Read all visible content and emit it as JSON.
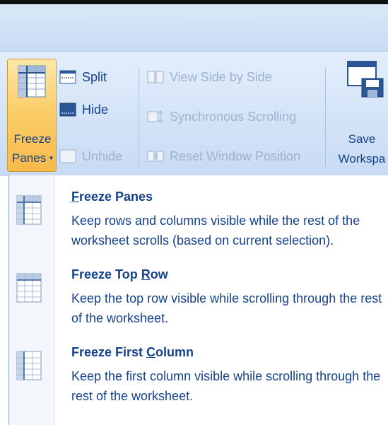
{
  "ribbon": {
    "freeze_panes": {
      "line1": "Freeze",
      "line2": "Panes",
      "caret": "▾"
    },
    "split": "Split",
    "hide": "Hide",
    "unhide": "Unhide",
    "view_side_by_side": "View Side by Side",
    "synchronous_scrolling": "Synchronous Scrolling",
    "reset_window_position": "Reset Window Position",
    "save_workspace": {
      "line1": "Save",
      "line2": "Workspa"
    }
  },
  "menu": {
    "items": [
      {
        "title": "Freeze Panes",
        "accel": "F",
        "desc": "Keep rows and columns visible while the rest of the worksheet scrolls (based on current selection).",
        "icon": "freeze-panes-icon"
      },
      {
        "title": "Freeze Top Row",
        "accel": "R",
        "desc": "Keep the top row visible while scrolling through the rest of the worksheet.",
        "icon": "freeze-top-row-icon"
      },
      {
        "title": "Freeze First Column",
        "accel": "C",
        "desc": "Keep the first column visible while scrolling through the rest of the worksheet.",
        "icon": "freeze-first-column-icon"
      }
    ]
  },
  "colors": {
    "text": "#15428b",
    "disabled": "#9fb2cc",
    "highlight": "#fbcf6a"
  }
}
